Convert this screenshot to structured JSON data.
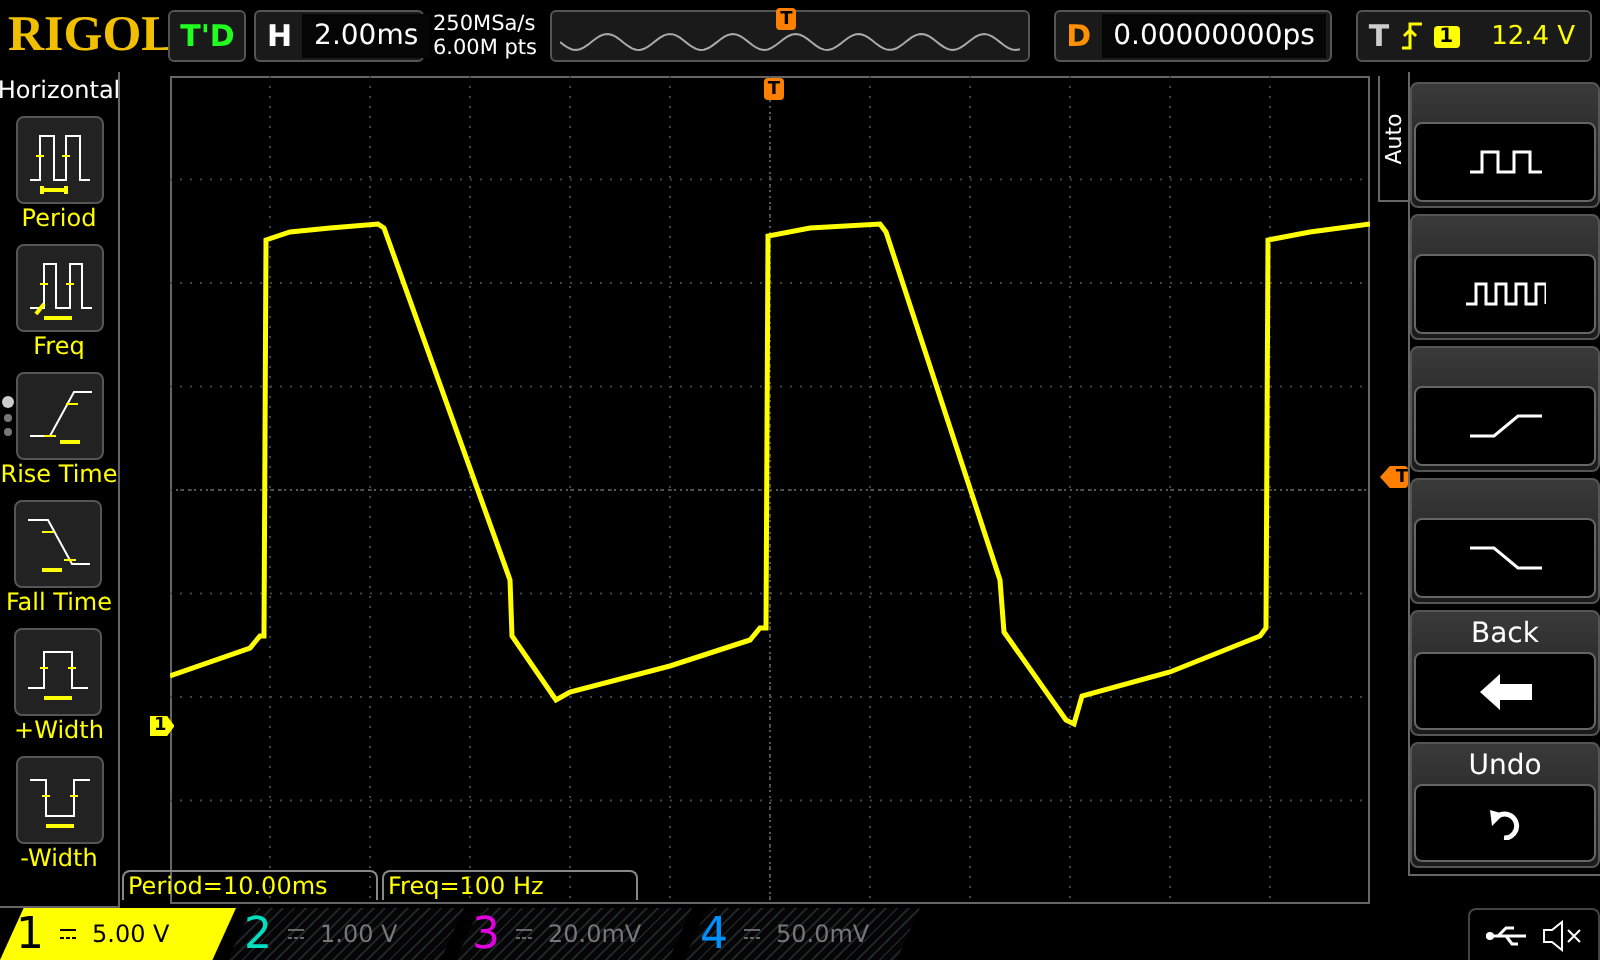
{
  "header": {
    "logo": "RIGOL",
    "run_status": "T'D",
    "timebase": {
      "label": "H",
      "value": "2.00ms"
    },
    "sample_rate": "250MSa/s",
    "memory_depth": "6.00M pts",
    "overview_marker": "T",
    "delay": {
      "label": "D",
      "value": "0.00000000ps"
    },
    "trigger": {
      "label": "T",
      "rising_edge": true,
      "source": "1",
      "level": "12.4 V"
    }
  },
  "measure_menu": {
    "title": "Horizontal",
    "pages": [
      {
        "selected": true
      },
      {
        "selected": false
      },
      {
        "selected": false
      }
    ],
    "items": [
      {
        "kind": "period",
        "label": "Period"
      },
      {
        "kind": "freq",
        "label": "Freq"
      },
      {
        "kind": "rise",
        "label": "Rise Time"
      },
      {
        "kind": "fall",
        "label": "Fall Time"
      },
      {
        "kind": "pwidth",
        "label": "+Width"
      },
      {
        "kind": "nwidth",
        "label": "-Width"
      }
    ]
  },
  "markers": {
    "trigger_position": "T",
    "trigger_level": "T",
    "channel": "1"
  },
  "measurements": [
    "Period=10.00ms",
    "Freq=100 Hz"
  ],
  "side_menu": {
    "tab": "Auto",
    "items": [
      {
        "kind": "single-pulse"
      },
      {
        "kind": "multi-pulse"
      },
      {
        "kind": "rise"
      },
      {
        "kind": "fall"
      },
      {
        "kind": "back",
        "label": "Back"
      },
      {
        "kind": "undo",
        "label": "Undo"
      }
    ]
  },
  "channels": [
    {
      "number": "1",
      "scale": "5.00 V",
      "on": true,
      "color": "#ffff00"
    },
    {
      "number": "2",
      "scale": "1.00 V",
      "on": false,
      "color": "#00e0c0"
    },
    {
      "number": "3",
      "scale": "20.0mV",
      "on": false,
      "color": "#e000e0"
    },
    {
      "number": "4",
      "scale": "50.0mV",
      "on": false,
      "color": "#0090ff"
    }
  ]
}
